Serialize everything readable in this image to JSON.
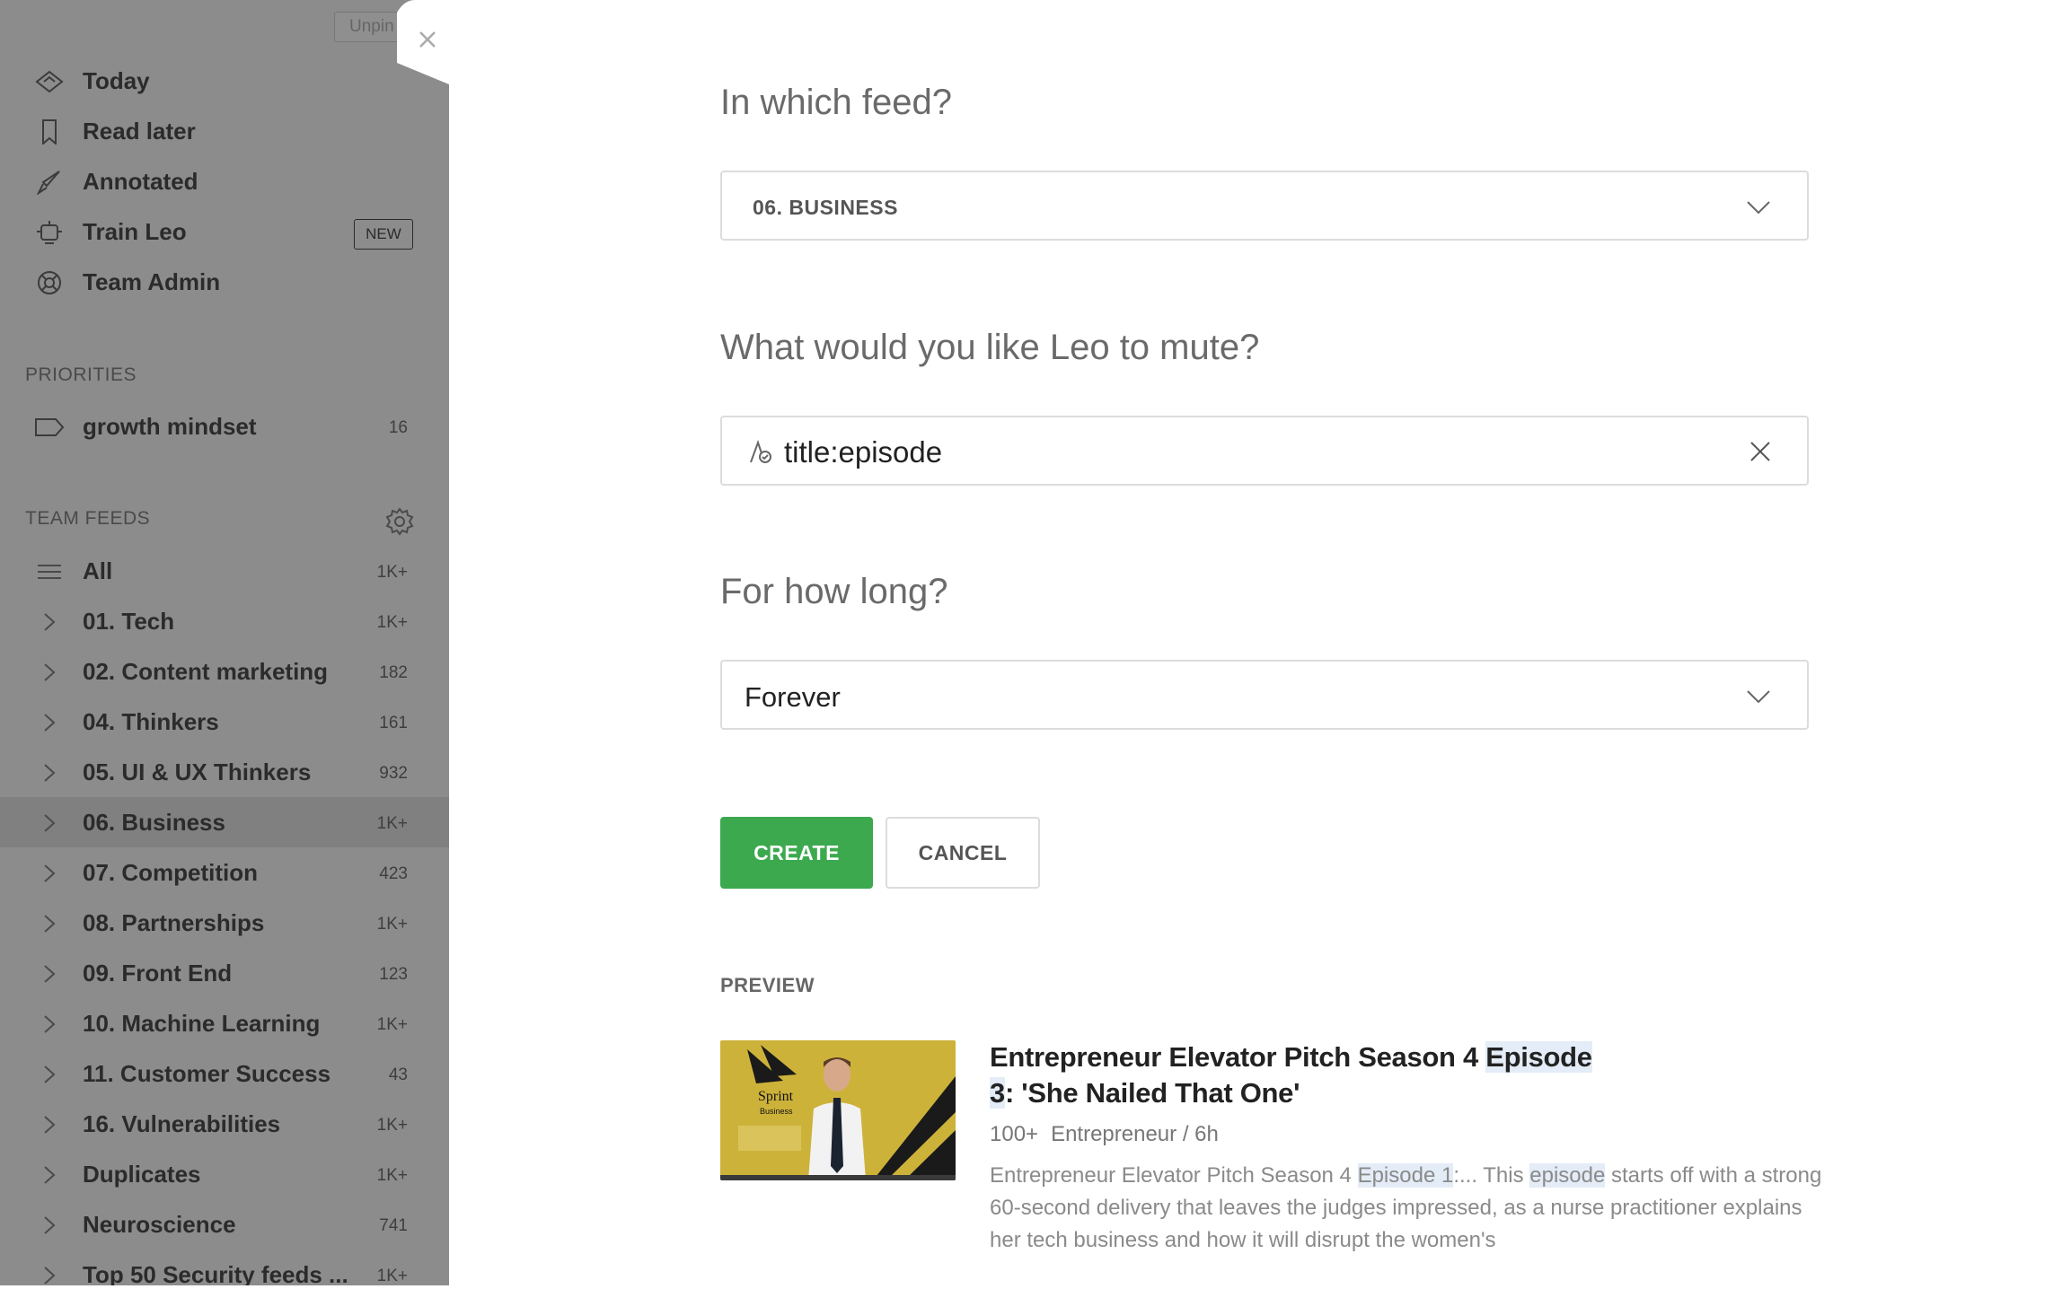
{
  "sidebar": {
    "unpin_label": "Unpin",
    "nav": [
      {
        "label": "Today",
        "icon": "today-icon"
      },
      {
        "label": "Read later",
        "icon": "bookmark-icon"
      },
      {
        "label": "Annotated",
        "icon": "highlighter-icon"
      },
      {
        "label": "Train Leo",
        "icon": "robot-icon",
        "badge": "NEW"
      },
      {
        "label": "Team Admin",
        "icon": "lifebuoy-icon"
      }
    ],
    "priorities_heading": "PRIORITIES",
    "priorities": [
      {
        "label": "growth mindset",
        "count": "16"
      }
    ],
    "team_feeds_heading": "TEAM FEEDS",
    "feeds": [
      {
        "label": "All",
        "count": "1K+"
      },
      {
        "label": "01. Tech",
        "count": "1K+"
      },
      {
        "label": "02. Content marketing",
        "count": "182"
      },
      {
        "label": "04. Thinkers",
        "count": "161"
      },
      {
        "label": "05. UI & UX Thinkers",
        "count": "932"
      },
      {
        "label": "06. Business",
        "count": "1K+",
        "selected": true
      },
      {
        "label": "07. Competition",
        "count": "423"
      },
      {
        "label": "08. Partnerships",
        "count": "1K+"
      },
      {
        "label": "09. Front End",
        "count": "123"
      },
      {
        "label": "10. Machine Learning",
        "count": "1K+"
      },
      {
        "label": "11. Customer Success",
        "count": "43"
      },
      {
        "label": "16. Vulnerabilities",
        "count": "1K+"
      },
      {
        "label": "Duplicates",
        "count": "1K+"
      },
      {
        "label": "Neuroscience",
        "count": "741"
      },
      {
        "label": "Top 50 Security feeds ...",
        "count": "1K+"
      }
    ]
  },
  "form": {
    "feed_question": "In which feed?",
    "feed_value": "06. BUSINESS",
    "mute_question": "What would you like Leo to mute?",
    "mute_value": "title:episode",
    "duration_question": "For how long?",
    "duration_value": "Forever",
    "create_label": "CREATE",
    "cancel_label": "CANCEL"
  },
  "preview": {
    "heading": "PREVIEW",
    "title_part1": "Entrepreneur Elevator Pitch Season 4 ",
    "title_hl1": "Episode",
    "title_hl2": "3",
    "title_part2": ": 'She Nailed That One'",
    "meta_count": "100+",
    "meta_source": "Entrepreneur / 6h",
    "snippet_part1": "Entrepreneur Elevator Pitch Season 4 ",
    "snippet_hl1": "Episode 1",
    "snippet_part2": ":... This ",
    "snippet_hl2": "episode",
    "snippet_part3": " starts off with a strong 60-second delivery that leaves the judges impressed, as a nurse practitioner explains her tech business and how it will disrupt the women's",
    "thumb_text_brand": "Sprint",
    "thumb_text_sub": "Business"
  },
  "colors": {
    "create_green": "#3ca94f",
    "sidebar_overlay": "#8c8c8c",
    "highlight": "#e3ecf7"
  }
}
